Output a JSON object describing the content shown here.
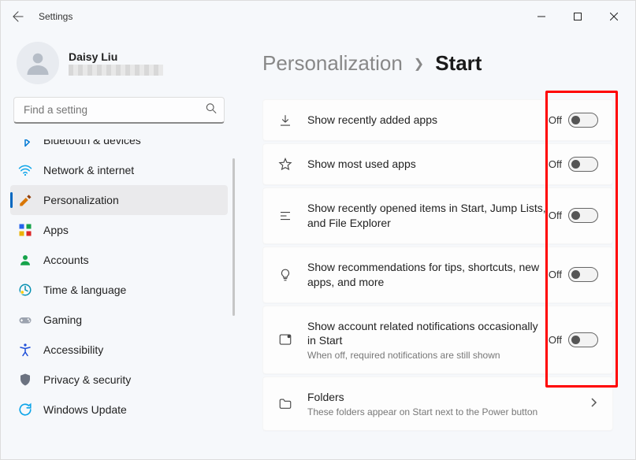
{
  "titlebar": {
    "title": "Settings"
  },
  "profile": {
    "name": "Daisy Liu"
  },
  "search": {
    "placeholder": "Find a setting"
  },
  "sidebar": {
    "items": [
      {
        "id": "bluetooth",
        "label": "Bluetooth & devices"
      },
      {
        "id": "network",
        "label": "Network & internet"
      },
      {
        "id": "personalization",
        "label": "Personalization",
        "selected": true
      },
      {
        "id": "apps",
        "label": "Apps"
      },
      {
        "id": "accounts",
        "label": "Accounts"
      },
      {
        "id": "time",
        "label": "Time & language"
      },
      {
        "id": "gaming",
        "label": "Gaming"
      },
      {
        "id": "accessibility",
        "label": "Accessibility"
      },
      {
        "id": "privacy",
        "label": "Privacy & security"
      },
      {
        "id": "update",
        "label": "Windows Update"
      }
    ]
  },
  "breadcrumb": {
    "prev": "Personalization",
    "current": "Start"
  },
  "settings": [
    {
      "icon": "download",
      "title": "Show recently added apps",
      "status": "Off",
      "toggle": true
    },
    {
      "icon": "star",
      "title": "Show most used apps",
      "status": "Off",
      "toggle": true
    },
    {
      "icon": "list",
      "title": "Show recently opened items in Start, Jump Lists, and File Explorer",
      "status": "Off",
      "toggle": true
    },
    {
      "icon": "bulb",
      "title": "Show recommendations for tips, shortcuts, new apps, and more",
      "status": "Off",
      "toggle": true
    },
    {
      "icon": "notification",
      "title": "Show account related notifications occasionally in Start",
      "sub": "When off, required notifications are still shown",
      "status": "Off",
      "toggle": true
    },
    {
      "icon": "folder",
      "title": "Folders",
      "sub": "These folders appear on Start next to the Power button",
      "arrow": true
    }
  ]
}
